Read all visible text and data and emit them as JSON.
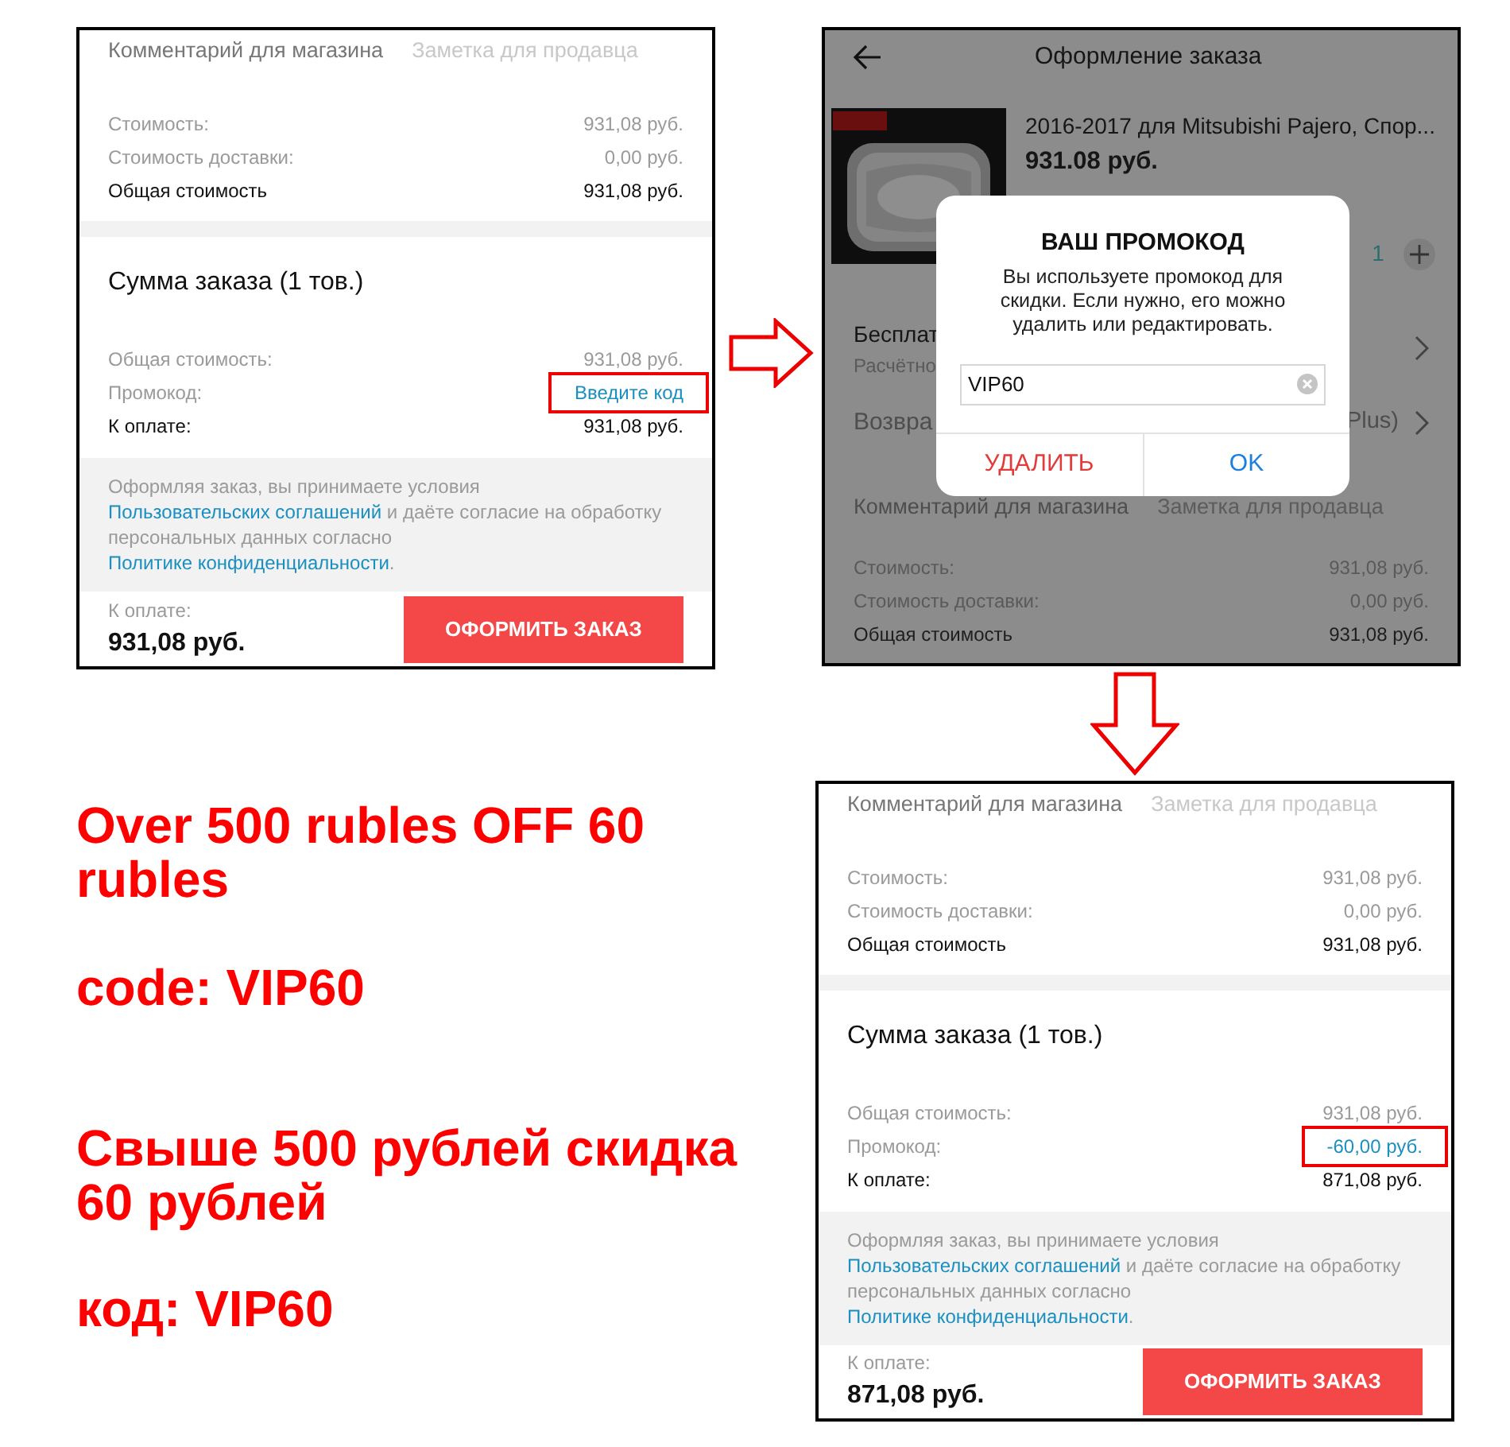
{
  "screens": [
    {
      "kind": "summary",
      "comment_label": "Комментарий для магазина",
      "seller_note_placeholder": "Заметка для продавца",
      "cost_rows": [
        {
          "label": "Стоимость:",
          "value": "931,08 руб.",
          "emphasis": false
        },
        {
          "label": "Стоимость доставки:",
          "value": "0,00 руб.",
          "emphasis": false
        },
        {
          "label": "Общая стоимость",
          "value": "931,08 руб.",
          "emphasis": true
        }
      ],
      "summary_title": "Сумма заказа (1 тов.)",
      "summary_rows": [
        {
          "label": "Общая стоимость:",
          "value": "931,08 руб.",
          "kind": "plain",
          "highlighted": false
        },
        {
          "label": "Промокод:",
          "value": "Введите код",
          "kind": "link",
          "highlighted": true
        },
        {
          "label": "К оплате:",
          "value": "931,08 руб.",
          "kind": "total",
          "highlighted": false
        }
      ],
      "terms": [
        {
          "text": "Оформляя заказ, вы принимаете условия ",
          "link": false
        },
        {
          "text": "Пользовательских соглашений",
          "link": true
        },
        {
          "text": " и даёте согласие на обработку персональных данных согласно ",
          "link": false
        },
        {
          "text": "Политике конфиденциальности",
          "link": true
        },
        {
          "text": ".",
          "link": false
        }
      ],
      "pay_label": "К оплате:",
      "pay_total": "931,08 руб.",
      "checkout_button": "ОФОРМИТЬ ЗАКАЗ"
    },
    {
      "kind": "dialog",
      "title": "Оформление заказа",
      "product": {
        "name": "2016-2017 для Mitsubishi Pajero, Спор...",
        "price": "931.08 руб.",
        "quantity": "1"
      },
      "rows": [
        {
          "title": "Бесплат",
          "subtitle": "Расчётно"
        },
        {
          "title": "Возвра",
          "trailing": "Plus)"
        }
      ],
      "comment_label": "Комментарий для магазина",
      "seller_note_placeholder": "Заметка для продавца",
      "cost_rows": [
        {
          "label": "Стоимость:",
          "value": "931,08 руб.",
          "emphasis": false
        },
        {
          "label": "Стоимость доставки:",
          "value": "0,00 руб.",
          "emphasis": false
        },
        {
          "label": "Общая стоимость",
          "value": "931,08 руб.",
          "emphasis": true
        }
      ],
      "dialog": {
        "title": "ВАШ ПРОМОКОД",
        "message": "Вы используете промокод для скидки. Если нужно, его можно удалить или редактировать.",
        "code": "VIP60",
        "buttons": [
          {
            "label": "УДАЛИТЬ",
            "kind": "destructive"
          },
          {
            "label": "OK",
            "kind": "default"
          }
        ]
      }
    },
    {
      "kind": "summary",
      "comment_label": "Комментарий для магазина",
      "seller_note_placeholder": "Заметка для продавца",
      "cost_rows": [
        {
          "label": "Стоимость:",
          "value": "931,08 руб.",
          "emphasis": false
        },
        {
          "label": "Стоимость доставки:",
          "value": "0,00 руб.",
          "emphasis": false
        },
        {
          "label": "Общая стоимость",
          "value": "931,08 руб.",
          "emphasis": true
        }
      ],
      "summary_title": "Сумма заказа (1 тов.)",
      "summary_rows": [
        {
          "label": "Общая стоимость:",
          "value": "931,08 руб.",
          "kind": "plain",
          "highlighted": false
        },
        {
          "label": "Промокод:",
          "value": "-60,00 руб.",
          "kind": "link",
          "highlighted": true
        },
        {
          "label": "К оплате:",
          "value": "871,08 руб.",
          "kind": "total",
          "highlighted": false
        }
      ],
      "terms": [
        {
          "text": "Оформляя заказ, вы принимаете условия ",
          "link": false
        },
        {
          "text": "Пользовательских соглашений",
          "link": true
        },
        {
          "text": " и даёте согласие на обработку персональных данных согласно ",
          "link": false
        },
        {
          "text": "Политике конфиденциальности",
          "link": true
        },
        {
          "text": ".",
          "link": false
        }
      ],
      "pay_label": "К оплате:",
      "pay_total": "871,08 руб.",
      "checkout_button": "ОФОРМИТЬ ЗАКАЗ"
    }
  ],
  "captions": [
    "Over 500 rubles OFF 60 rubles",
    "code: VIP60",
    "Свыше 500 рублей скидка 60 рублей",
    "код: VIP60"
  ]
}
